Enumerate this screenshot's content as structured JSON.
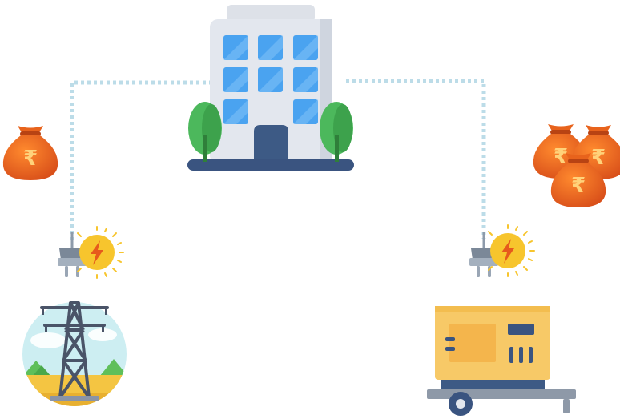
{
  "diagram": {
    "nodes": [
      {
        "id": "building",
        "icon": "office-building-icon"
      },
      {
        "id": "grid",
        "icon": "power-transmission-tower-icon"
      },
      {
        "id": "generator",
        "icon": "diesel-generator-icon"
      }
    ],
    "connectors": [
      {
        "from": "grid",
        "to": "building",
        "icon": "power-plug-icon",
        "style": "dotted"
      },
      {
        "from": "generator",
        "to": "building",
        "icon": "power-plug-icon",
        "style": "dotted"
      }
    ],
    "cost_indicators": [
      {
        "node": "grid",
        "money_bags": 1,
        "symbol": "₹"
      },
      {
        "node": "generator",
        "money_bags": 3,
        "symbol": "₹"
      }
    ]
  },
  "colors": {
    "connector": "#bcdce8",
    "money_bag": "#ec6a1e",
    "building": "#e2e6ee",
    "window": "#4aa3f0",
    "tree": "#4cb85c",
    "generator": "#f7c967",
    "plug": "#8e9bab",
    "bolt_badge": "#f7c52d"
  }
}
